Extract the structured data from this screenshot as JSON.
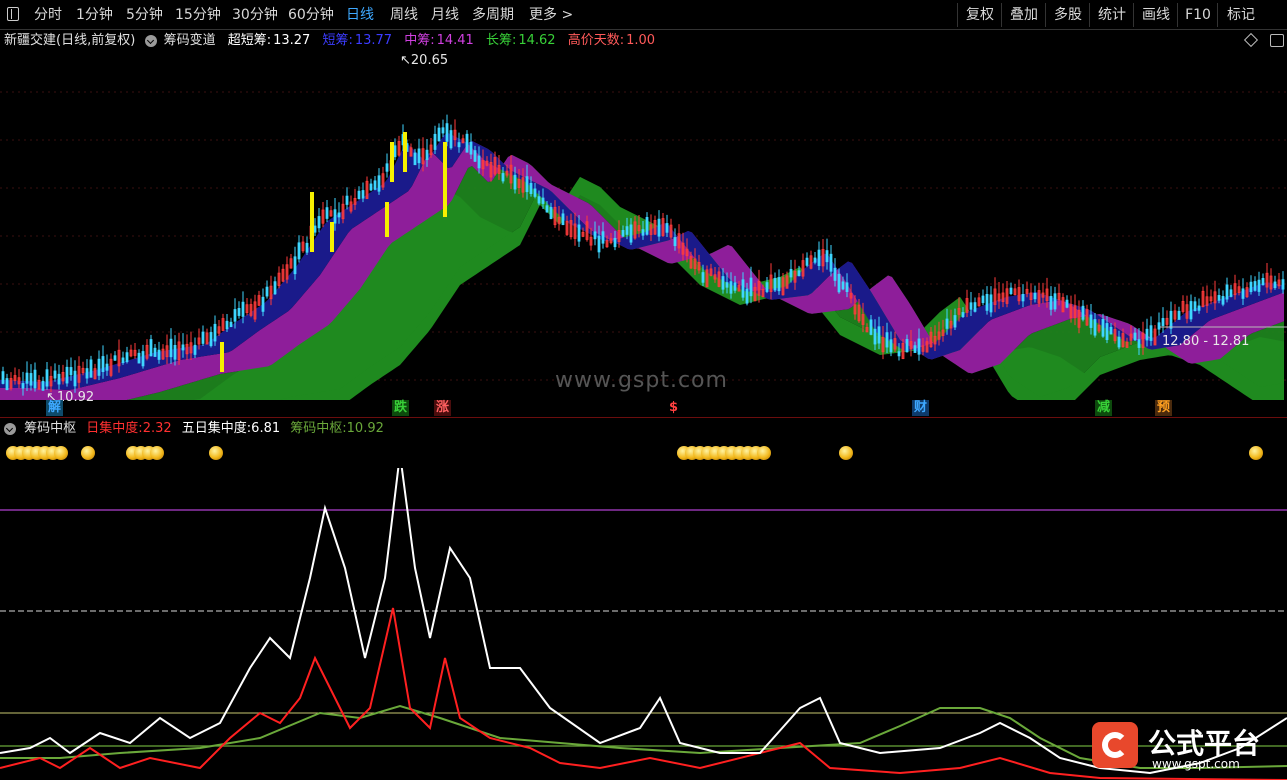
{
  "toolbar": {
    "left_items": [
      "分时",
      "1分钟",
      "5分钟",
      "15分钟",
      "30分钟",
      "60分钟",
      "日线",
      "周线",
      "月线",
      "多周期",
      "更多 >"
    ],
    "active_index": 6,
    "right_items": [
      "复权",
      "叠加",
      "多股",
      "统计",
      "画线",
      "F10",
      "标记"
    ]
  },
  "main_title": {
    "stock": "新疆交建(日线,前复权)",
    "indicator": "筹码变道",
    "ultra_short_label": "超短筹:",
    "ultra_short_value": "13.27",
    "short_label": "短筹:",
    "short_value": "13.77",
    "mid_label": "中筹:",
    "mid_value": "14.41",
    "long_label": "长筹:",
    "long_value": "14.62",
    "high_days_label": "高价天数:",
    "high_days_value": "1.00"
  },
  "price_labels": {
    "high": "20.65",
    "low": "10.92",
    "range": "12.80 - 12.81"
  },
  "signals": [
    {
      "text": "解",
      "color": "#3ea8ff"
    },
    {
      "text": "跌",
      "color": "#38d038"
    },
    {
      "text": "涨",
      "color": "#ff6060"
    },
    {
      "text": "$",
      "color": "#ff4040"
    },
    {
      "text": "财",
      "color": "#3ea8ff"
    },
    {
      "text": "减",
      "color": "#38d038"
    },
    {
      "text": "预",
      "color": "#ffa020"
    }
  ],
  "sub_title": {
    "indicator": "筹码中枢",
    "daily_label": "日集中度:",
    "daily_value": "2.32",
    "five_label": "五日集中度:",
    "five_value": "6.81",
    "center_label": "筹码中枢:",
    "center_value": "10.92"
  },
  "watermark": "www.gspt.com",
  "logo": {
    "name": "公式平台",
    "url": "www.gspt.com"
  },
  "colors": {
    "up": "#ff3b3b",
    "down": "#3fd6ff",
    "purple": "#8e1e9a",
    "green": "#1f8a1f",
    "navy": "#1a1a8a",
    "white_line": "#ffffff",
    "red_line": "#ff2020",
    "green_line": "#6aa83a"
  },
  "chart_data": [
    {
      "type": "line",
      "title": "筹码变道",
      "series": [
        {
          "name": "超短筹",
          "last": 13.27
        },
        {
          "name": "短筹",
          "last": 13.77
        },
        {
          "name": "中筹",
          "last": 14.41
        },
        {
          "name": "长筹",
          "last": 14.62
        }
      ],
      "high_marker": 20.65,
      "low_marker": 10.92
    },
    {
      "type": "line",
      "title": "筹码中枢",
      "series": [
        {
          "name": "日集中度",
          "last": 2.32
        },
        {
          "name": "五日集中度",
          "last": 6.81
        },
        {
          "name": "筹码中枢",
          "last": 10.92
        }
      ]
    }
  ]
}
